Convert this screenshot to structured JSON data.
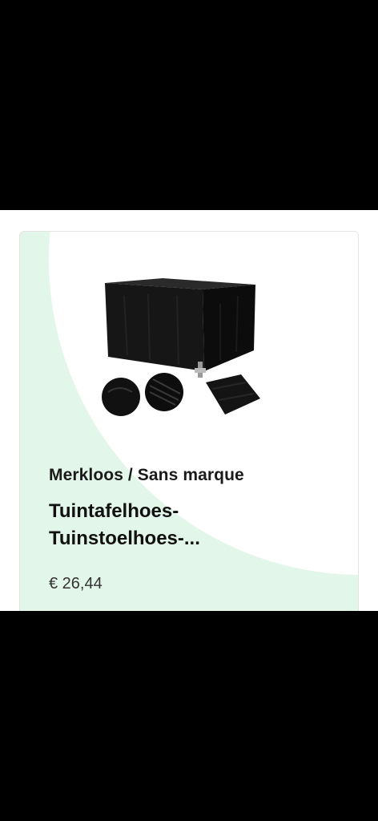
{
  "product": {
    "brand": "Merkloos / Sans marque",
    "title_line1": "Tuintafelhoes-",
    "title_line2": "Tuinstoelhoes-...",
    "price": "€ 26,44",
    "image_icon": "garden-table-cover-image"
  },
  "colors": {
    "card_background": "#e3f6ea",
    "card_foreground": "#ffffff",
    "frame": "#000000",
    "text": "#1a1a1a"
  }
}
